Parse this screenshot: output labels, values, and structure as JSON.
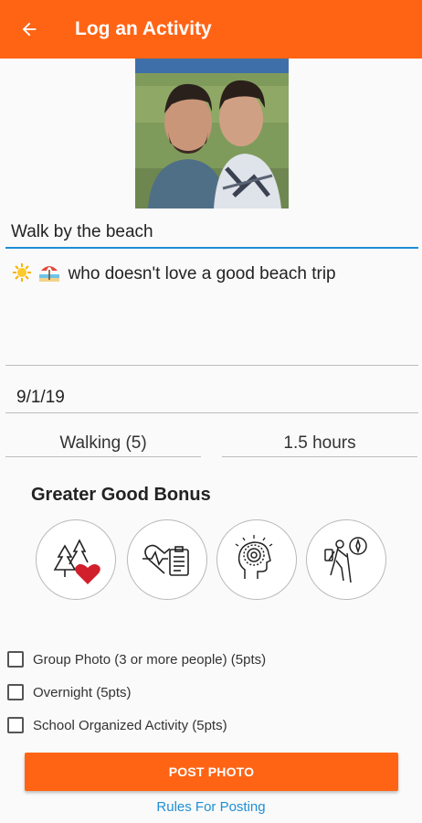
{
  "appbar": {
    "title": "Log an Activity",
    "back_icon": "arrow-left-icon"
  },
  "activity": {
    "title_value": "Walk by the beach",
    "description_text": "who doesn't love a good beach trip",
    "description_emojis": [
      "sun-icon",
      "beach-umbrella-icon"
    ],
    "date": "9/1/19",
    "type": "Walking (5)",
    "duration": "1.5 hours"
  },
  "bonus": {
    "title": "Greater Good Bonus",
    "icons": [
      "trees-heart-icon",
      "health-clipboard-icon",
      "mind-focus-icon",
      "hiker-compass-icon"
    ]
  },
  "checkboxes": [
    {
      "label": "Group Photo (3 or more people) (5pts)",
      "checked": false
    },
    {
      "label": "Overnight (5pts)",
      "checked": false
    },
    {
      "label": "School Organized Activity (5pts)",
      "checked": false
    }
  ],
  "actions": {
    "post_label": "POST PHOTO",
    "rules_label": "Rules For Posting"
  },
  "colors": {
    "accent": "#ff6415",
    "link": "#1f8fd6",
    "input_focus": "#1f8fd6"
  }
}
